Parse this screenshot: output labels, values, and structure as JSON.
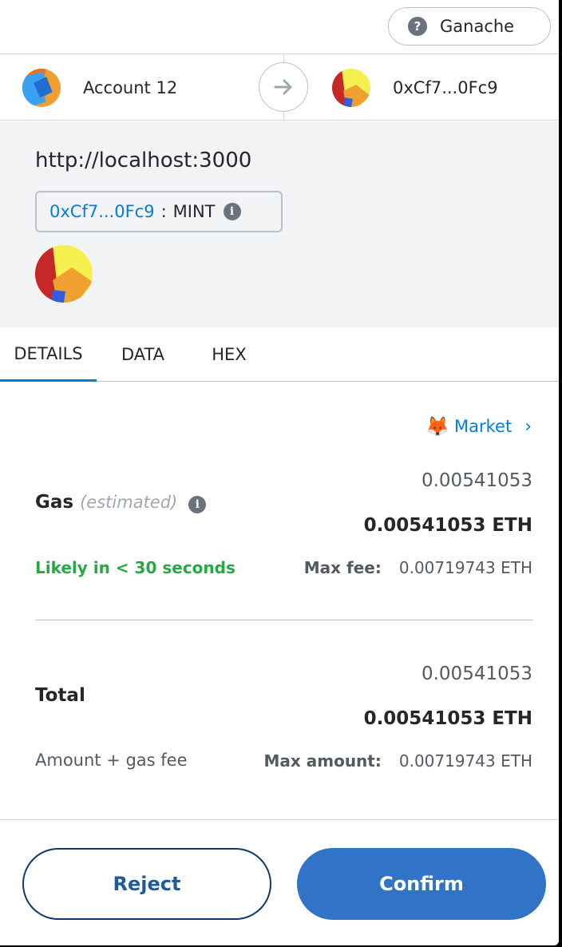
{
  "network": {
    "label": "Ganache",
    "help_glyph": "?"
  },
  "from_account": {
    "name": "Account 12"
  },
  "to_account": {
    "address": "0xCf7...0Fc9"
  },
  "origin": {
    "url": "http://localhost:3000",
    "contract_address": "0xCf7...0Fc9",
    "separator": ":",
    "method": "MINT"
  },
  "tabs": [
    {
      "label": "DETAILS",
      "active": true
    },
    {
      "label": "DATA",
      "active": false
    },
    {
      "label": "HEX",
      "active": false
    }
  ],
  "market": {
    "label": "Market",
    "icon": "fox-icon"
  },
  "gas": {
    "label": "Gas",
    "qualifier": "(estimated)",
    "fiat_value": "0.00541053",
    "eth_value": "0.00541053 ETH",
    "timing": "Likely in < 30 seconds",
    "max_fee_label": "Max fee:",
    "max_fee_value": "0.00719743 ETH"
  },
  "total": {
    "label": "Total",
    "fiat_value": "0.00541053",
    "eth_value": "0.00541053 ETH",
    "subtitle": "Amount + gas fee",
    "max_amount_label": "Max amount:",
    "max_amount_value": "0.00719743 ETH"
  },
  "actions": {
    "reject_label": "Reject",
    "confirm_label": "Confirm"
  },
  "colors": {
    "link_blue": "#037dd6",
    "success_green": "#28a745",
    "confirm_blue": "#3173c6",
    "reject_border": "#0f3a6c"
  }
}
